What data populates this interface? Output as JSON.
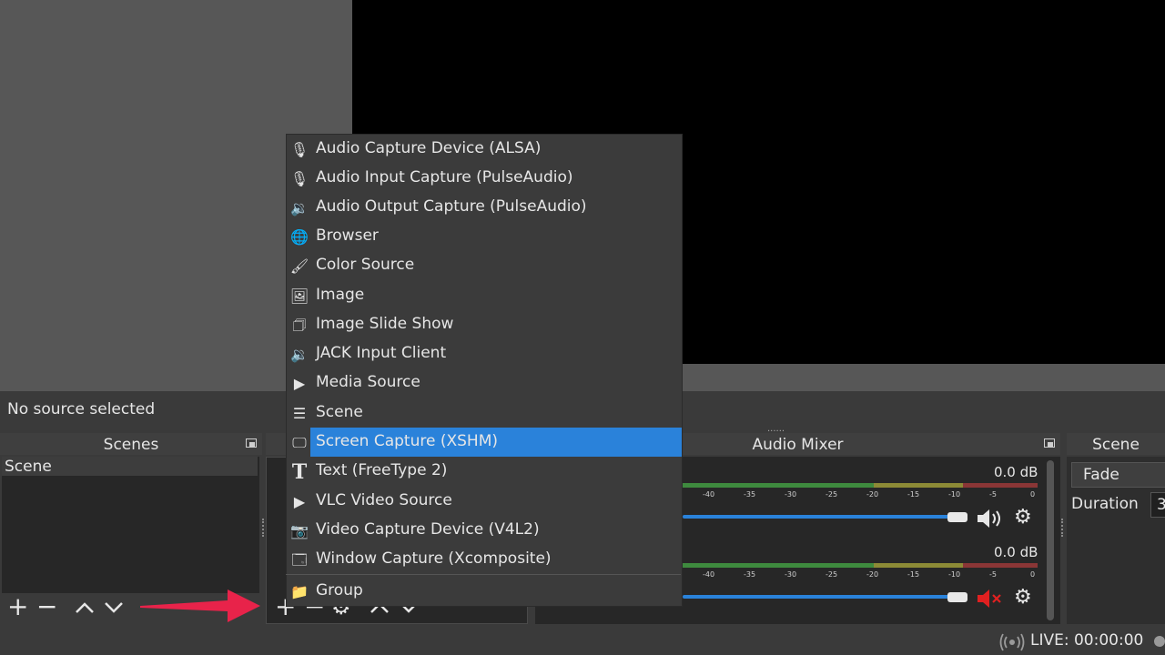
{
  "status": {
    "no_source": "No source selected",
    "live": "LIVE: 00:00:00"
  },
  "docks": {
    "scenes_title": "Scenes",
    "mixer_title": "Audio Mixer",
    "transitions_title": "Scene"
  },
  "scenes": {
    "items": [
      "Scene"
    ]
  },
  "mixer": {
    "channels": [
      {
        "db": "0.0 dB",
        "muted": false
      },
      {
        "db": "0.0 dB",
        "muted": true
      }
    ],
    "ticks": [
      "-40",
      "-35",
      "-30",
      "-25",
      "-20",
      "-15",
      "-10",
      "-5",
      "0"
    ]
  },
  "transitions": {
    "selected": "Fade",
    "duration_label": "Duration",
    "duration_value": "3"
  },
  "source_menu": {
    "items": [
      {
        "label": "Audio Capture Device (ALSA)",
        "icon": "microphone-icon"
      },
      {
        "label": "Audio Input Capture (PulseAudio)",
        "icon": "microphone-icon"
      },
      {
        "label": "Audio Output Capture (PulseAudio)",
        "icon": "speaker-icon"
      },
      {
        "label": "Browser",
        "icon": "globe-icon"
      },
      {
        "label": "Color Source",
        "icon": "brush-icon"
      },
      {
        "label": "Image",
        "icon": "image-icon"
      },
      {
        "label": "Image Slide Show",
        "icon": "slideshow-icon"
      },
      {
        "label": "JACK Input Client",
        "icon": "speaker-icon"
      },
      {
        "label": "Media Source",
        "icon": "play-icon"
      },
      {
        "label": "Scene",
        "icon": "list-icon"
      },
      {
        "label": "Screen Capture (XSHM)",
        "icon": "monitor-icon",
        "selected": true
      },
      {
        "label": "Text (FreeType 2)",
        "icon": "text-icon"
      },
      {
        "label": "VLC Video Source",
        "icon": "play-icon"
      },
      {
        "label": "Video Capture Device (V4L2)",
        "icon": "camera-icon"
      },
      {
        "label": "Window Capture (Xcomposite)",
        "icon": "window-icon"
      },
      {
        "label": "Group",
        "icon": "folder-icon"
      }
    ]
  },
  "colors": {
    "accent": "#2a82da",
    "arrow": "#e8234a",
    "mute_red": "#e02020"
  }
}
